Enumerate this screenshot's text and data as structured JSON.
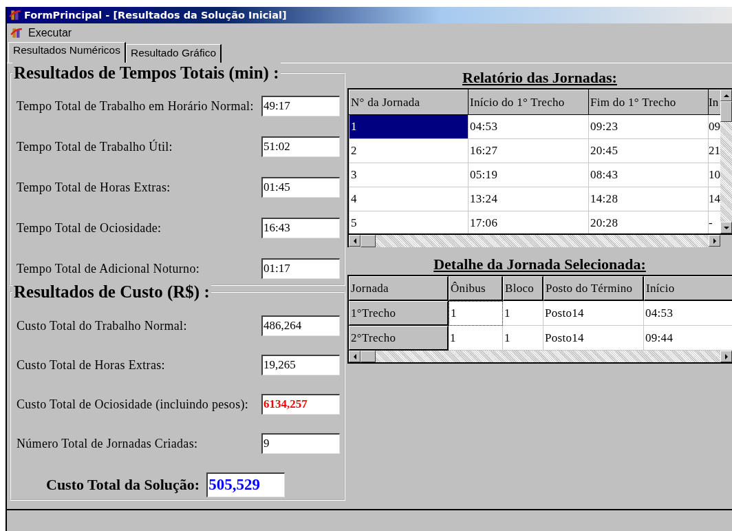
{
  "window": {
    "title": "FormPrincipal - [Resultados da Solução Inicial]"
  },
  "menu": [
    {
      "label": "Executar"
    }
  ],
  "tabs": [
    {
      "label": "Resultados Numéricos",
      "selected": true
    },
    {
      "label": "Resultado Gráfico",
      "selected": false
    }
  ],
  "time_group": {
    "title": "Resultados de Tempos Totais (min) :",
    "fields": [
      {
        "label": "Tempo Total de Trabalho em Horário Normal:",
        "value": "49:17",
        "color": "#000000"
      },
      {
        "label": "Tempo Total de Trabalho Útil:",
        "value": "51:02",
        "color": "#000000"
      },
      {
        "label": "Tempo Total de Horas Extras:",
        "value": "01:45",
        "color": "#000000"
      },
      {
        "label": "Tempo Total de Ociosidade:",
        "value": "16:43",
        "color": "#000000"
      },
      {
        "label": "Tempo Total de Adicional Noturno:",
        "value": "01:17",
        "color": "#000000"
      }
    ]
  },
  "cost_group": {
    "title": "Resultados de Custo (R$) :",
    "fields": [
      {
        "label": "Custo Total do Trabalho Normal:",
        "value": "486,264",
        "color": "#000000"
      },
      {
        "label": "Custo Total de Horas Extras:",
        "value": "19,265",
        "color": "#000000"
      },
      {
        "label": "Custo Total de Ociosidade (incluindo pesos):",
        "value": "6134,257",
        "color": "#ff0000"
      },
      {
        "label": "Número Total de Jornadas Criadas:",
        "value": "9",
        "color": "#000000"
      }
    ],
    "total": {
      "label": "Custo Total da Solução:",
      "value": "505,529",
      "color": "#0000ff"
    }
  },
  "journeys": {
    "title": "Relatório das Jornadas:",
    "columns": [
      "N° da Jornada",
      "Início do 1° Trecho",
      "Fim do 1° Trecho",
      "In"
    ],
    "rows": [
      {
        "cells": [
          "1",
          "04:53",
          "09:23",
          "09"
        ],
        "selected": true
      },
      {
        "cells": [
          "2",
          "16:27",
          "20:45",
          "21"
        ],
        "selected": false
      },
      {
        "cells": [
          "3",
          "05:19",
          "08:43",
          "10"
        ],
        "selected": false
      },
      {
        "cells": [
          "4",
          "13:24",
          "14:28",
          "14"
        ],
        "selected": false
      },
      {
        "cells": [
          "5",
          "17:06",
          "20:28",
          "-"
        ],
        "selected": false
      }
    ]
  },
  "detail": {
    "title": "Detalhe da Jornada Selecionada:",
    "columns": [
      "Jornada",
      "Ônibus",
      "Bloco",
      "Posto do Término",
      "Início"
    ],
    "rows": [
      {
        "cells": [
          "1°Trecho",
          "1",
          "1",
          "Posto14",
          "04:53"
        ],
        "focused": true
      },
      {
        "cells": [
          "2°Trecho",
          "1",
          "1",
          "Posto14",
          "09:44"
        ],
        "focused": false
      }
    ]
  }
}
